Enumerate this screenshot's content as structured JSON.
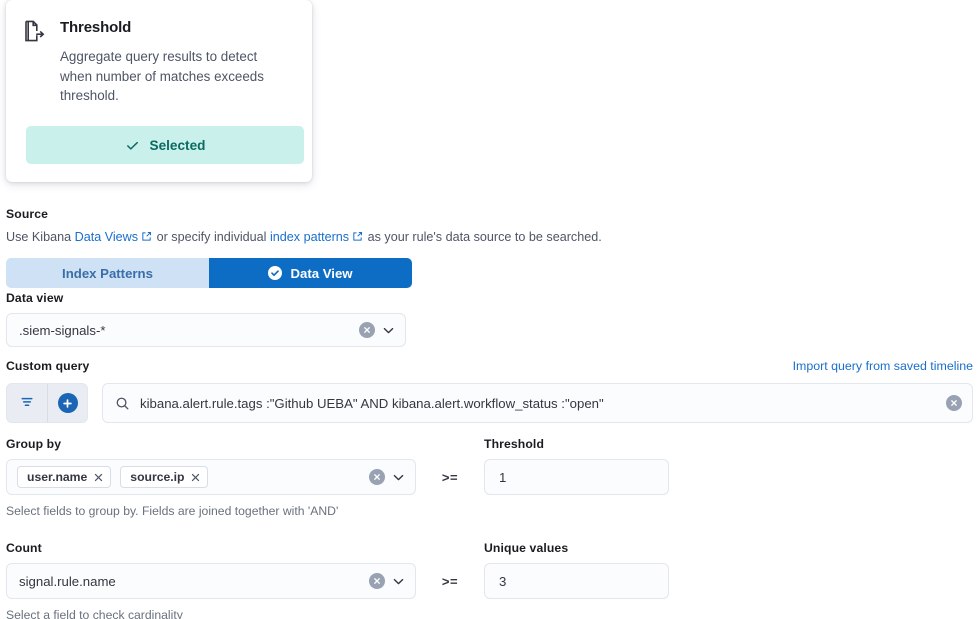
{
  "rule_card": {
    "icon": "document-export-icon",
    "title": "Threshold",
    "description": "Aggregate query results to detect when number of matches exceeds threshold.",
    "selected_label": "Selected",
    "selected_bg": "#c9f0ea",
    "selected_fg": "#0b6b63"
  },
  "source": {
    "label": "Source",
    "desc_before": "Use Kibana ",
    "link1": "Data Views",
    "desc_middle": " or specify individual ",
    "link2": "index patterns",
    "desc_after": " as your rule's data source to be searched.",
    "toggle": {
      "index_patterns_label": "Index Patterns",
      "data_view_label": "Data View",
      "active": "Data View",
      "active_bg": "#0d6dc4",
      "inactive_bg": "#cfe2f5"
    }
  },
  "data_view": {
    "label": "Data view",
    "value": ".siem-signals-*",
    "clear_icon": "clear-circle-icon",
    "caret_icon": "chevron-down-icon"
  },
  "custom_query": {
    "label": "Custom query",
    "import_link": "Import query from saved timeline",
    "filter_icon": "filter-icon",
    "add_icon": "plus-icon",
    "search_icon": "search-icon",
    "value": "kibana.alert.rule.tags :\"Github UEBA\" AND kibana.alert.workflow_status :\"open\"",
    "clear_icon": "clear-circle-icon"
  },
  "group_by": {
    "label": "Group by",
    "pills": [
      "user.name",
      "source.ip"
    ],
    "help": "Select fields to group by. Fields are joined together with 'AND'",
    "clear_icon": "clear-circle-icon",
    "caret_icon": "chevron-down-icon"
  },
  "threshold": {
    "label": "Threshold",
    "operator": ">=",
    "value": "1"
  },
  "count": {
    "label": "Count",
    "value": "signal.rule.name",
    "help": "Select a field to check cardinality",
    "clear_icon": "clear-circle-icon",
    "caret_icon": "chevron-down-icon"
  },
  "unique_values": {
    "label": "Unique values",
    "operator": ">=",
    "value": "3"
  }
}
